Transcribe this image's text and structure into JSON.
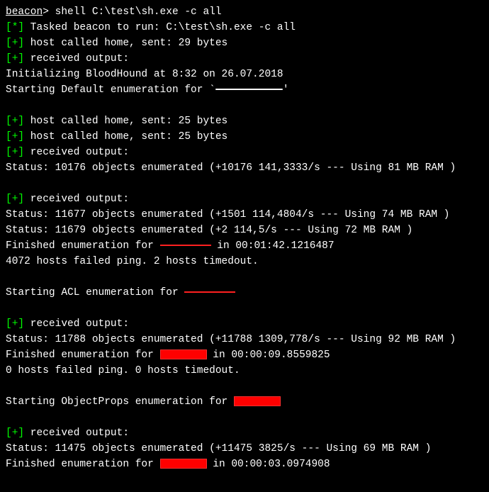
{
  "prompt": {
    "label": "beacon",
    "gt": ">",
    "command": " shell C:\\test\\sh.exe -c all"
  },
  "markers": {
    "star": "[*]",
    "plus": "[+]"
  },
  "lines": {
    "tasked": " Tasked beacon to run: C:\\test\\sh.exe -c all",
    "sent29": " host called home, sent: 29 bytes",
    "recv": " received output:",
    "init": "Initializing BloodHound at 8:32 on 26.07.2018",
    "startDefault": "Starting Default enumeration for `",
    "sent25": " host called home, sent: 25 bytes",
    "status10176": "Status: 10176 objects enumerated (+10176 141,3333/s --- Using 81 MB RAM )",
    "status11677": "Status: 11677 objects enumerated (+1501 114,4804/s --- Using 74 MB RAM )",
    "status11679": "Status: 11679 objects enumerated (+2 114,5/s --- Using 72 MB RAM )",
    "finEnum1_a": "Finished enumeration for ",
    "finEnum1_b": " in 00:01:42.1216487",
    "pingFail1": "4072 hosts failed ping. 2 hosts timedout.",
    "startACL": "Starting ACL enumeration for ",
    "status11788": "Status: 11788 objects enumerated (+11788 1309,778/s --- Using 92 MB RAM )",
    "finEnum2_a": "Finished enumeration for ",
    "finEnum2_b": " in 00:00:09.8559825",
    "pingFail2": "0 hosts failed ping. 0 hosts timedout.",
    "startObjProps": "Starting ObjectProps enumeration for ",
    "status11475": "Status: 11475 objects enumerated (+11475 3825/s --- Using 69 MB RAM )",
    "finEnum3_a": "Finished enumeration for ",
    "finEnum3_b": " in 00:00:03.0974908",
    "quote": "'"
  }
}
